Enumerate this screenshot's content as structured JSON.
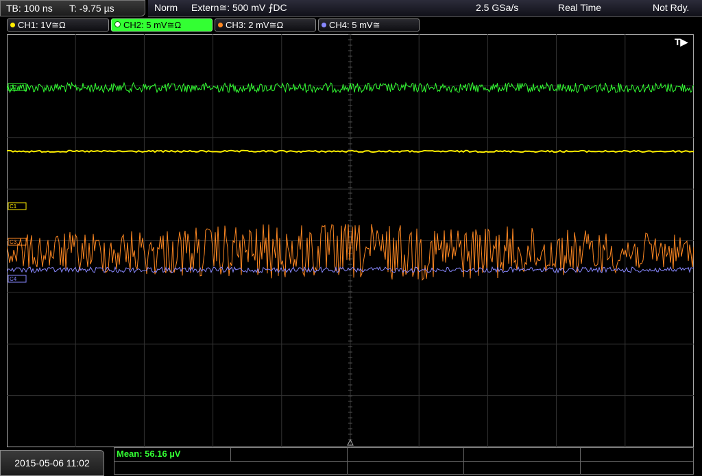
{
  "timebase": {
    "tb_label": "TB: 100 ns",
    "t_label": "T: -9.75 µs"
  },
  "status": {
    "mode": "Norm",
    "trigger": "Extern≅: 500 mV ⨍DC",
    "sample_rate": "2.5 GSa/s",
    "acq_mode": "Real Time",
    "state": "Not Rdy."
  },
  "channels": [
    {
      "label": "CH1: 1V≅Ω",
      "color": "#ffee00"
    },
    {
      "label": "CH2: 5 mV≅Ω",
      "color": "#33ff33"
    },
    {
      "label": "CH3: 2 mV≅Ω",
      "color": "#ff8822"
    },
    {
      "label": "CH4: 5 mV≅",
      "color": "#8888ff"
    }
  ],
  "markers": {
    "c1": "C1",
    "c2": "C2",
    "c3": "C3",
    "c4": "C4",
    "trigger": "T▶"
  },
  "footer": {
    "datetime": "2015-05-06 11:02",
    "mean_label": "Mean: 56.16 µV"
  }
}
